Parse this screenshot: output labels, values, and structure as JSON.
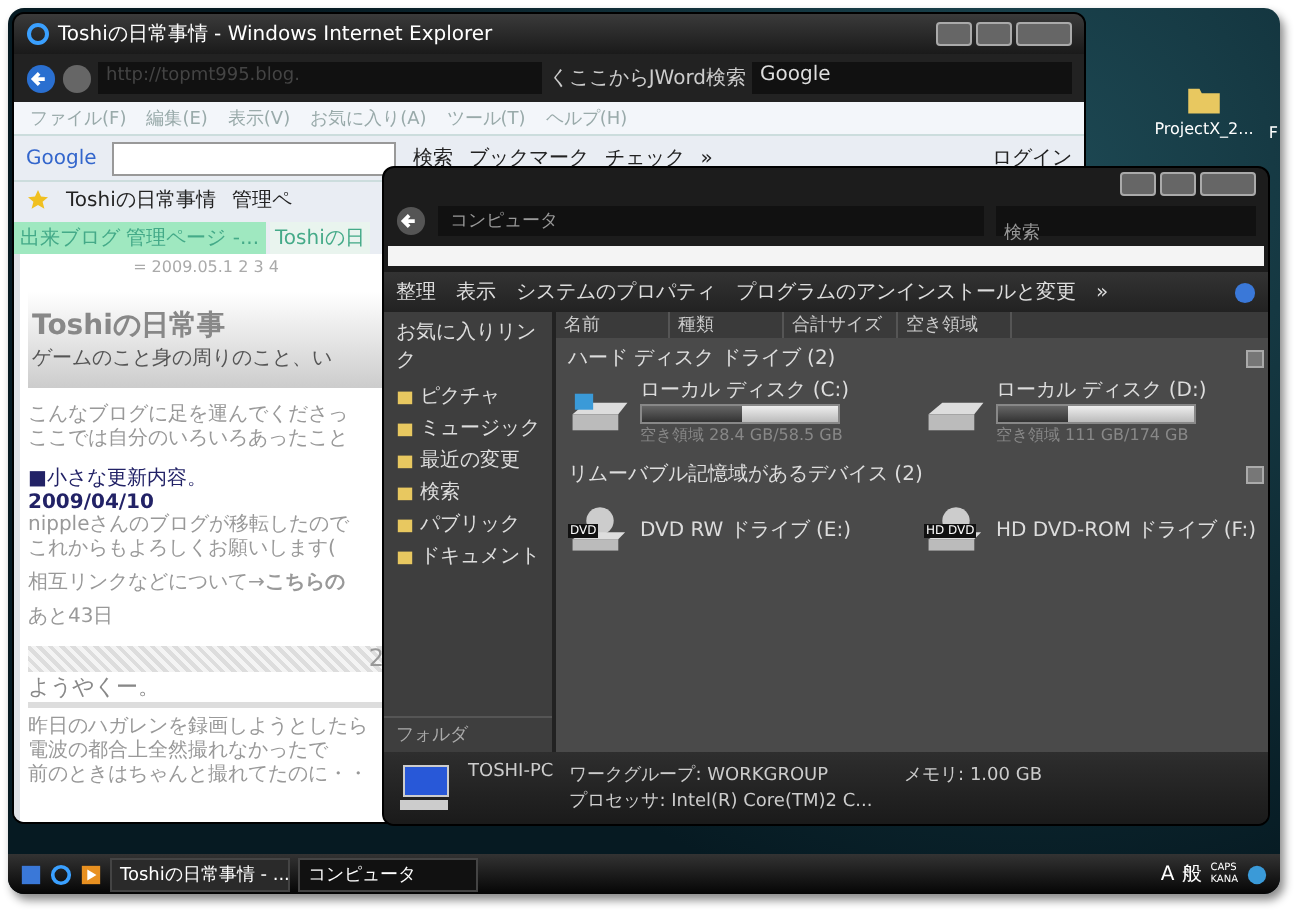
{
  "desktop_icons": [
    {
      "label": "ProjectX_2..."
    },
    {
      "label": "F"
    }
  ],
  "browser": {
    "title": "Toshiの日常事情 - Windows Internet Explorer",
    "address": "http://topmt995.blog.",
    "search_provider": "くここからJWord検索",
    "search_engine": "Google",
    "menu": [
      "ファイル(F)",
      "編集(E)",
      "表示(V)",
      "お気に入り(A)",
      "ツール(T)",
      "ヘルプ(H)"
    ],
    "google_toolbar": {
      "logo": "Google",
      "search_button": "検索",
      "bookmarks": "ブックマーク",
      "check": "チェック",
      "more": "»",
      "login": "ログイン"
    },
    "favorites": [
      "Toshiの日常事情",
      "管理ペ"
    ],
    "tabs": [
      {
        "label": "出来ブログ 管理ページ -...",
        "selected": false
      },
      {
        "label": "Toshiの日",
        "selected": true
      }
    ],
    "page": {
      "date_nav": "= 2009.05.1 2 3 4",
      "blog_title": "Toshiの日常事",
      "blog_subtitle": "ゲームのこと身の周りのこと、い",
      "intro": [
        "こんなブログに足を運んでくださっ",
        "ここでは自分のいろいろあったこと"
      ],
      "update_heading": "■小さな更新内容。",
      "update_date": "2009/04/10",
      "update_text": [
        "nippleさんのブログが移転したので",
        "これからもよろしくお願いします("
      ],
      "link_text": "相互リンクなどについて→**こちらの**",
      "countdown": "あと43日",
      "entry_date": "2",
      "entry_title": "ようやくー。",
      "entry_text": [
        "昨日のハガレンを録画しようとしたら",
        "電波の都合上全然撮れなかったで",
        "前のときはちゃんと撮れてたのに・・"
      ]
    }
  },
  "explorer": {
    "address": "コンピュータ",
    "search_placeholder": "検索",
    "toolbar": [
      "整理",
      "表示",
      "システムのプロパティ",
      "プログラムのアンインストールと変更",
      "»"
    ],
    "favorites_heading": "お気に入りリンク",
    "links": [
      "ピクチャ",
      "ミュージック",
      "最近の変更",
      "検索",
      "パブリック",
      "ドキュメント"
    ],
    "folders": "フォルダ",
    "columns": [
      "名前",
      "種類",
      "合計サイズ",
      "空き領域"
    ],
    "groups": [
      {
        "title": "ハード ディスク ドライブ (2)",
        "items": [
          {
            "kind": "disk",
            "name": "ローカル ディスク (C:)",
            "level": 0.51,
            "free": "空き領域 28.4 GB/58.5 GB",
            "system": true
          },
          {
            "kind": "disk",
            "name": "ローカル ディスク (D:)",
            "level": 0.36,
            "free": "空き領域 111 GB/174 GB",
            "system": false
          }
        ]
      },
      {
        "title": "リムーバブル記憶域があるデバイス (2)",
        "items": [
          {
            "kind": "optical",
            "name": "DVD RW ドライブ (E:)",
            "badge": "DVD"
          },
          {
            "kind": "optical",
            "name": "HD DVD-ROM ドライブ (F:)",
            "badge": "HD DVD"
          }
        ]
      }
    ],
    "details": {
      "computer": "TOSHI-PC",
      "workgroup": "ワークグループ: WORKGROUP",
      "memory": "メモリ: 1.00 GB",
      "processor": "プロセッサ: Intel(R) Core(TM)2 C..."
    }
  },
  "taskbar": {
    "tasks": [
      {
        "label": "Toshiの日常事情 - ...",
        "selected": false
      },
      {
        "label": "コンピュータ",
        "selected": true
      }
    ],
    "tray": [
      "A",
      "般",
      "CAPS",
      "KANA"
    ]
  }
}
